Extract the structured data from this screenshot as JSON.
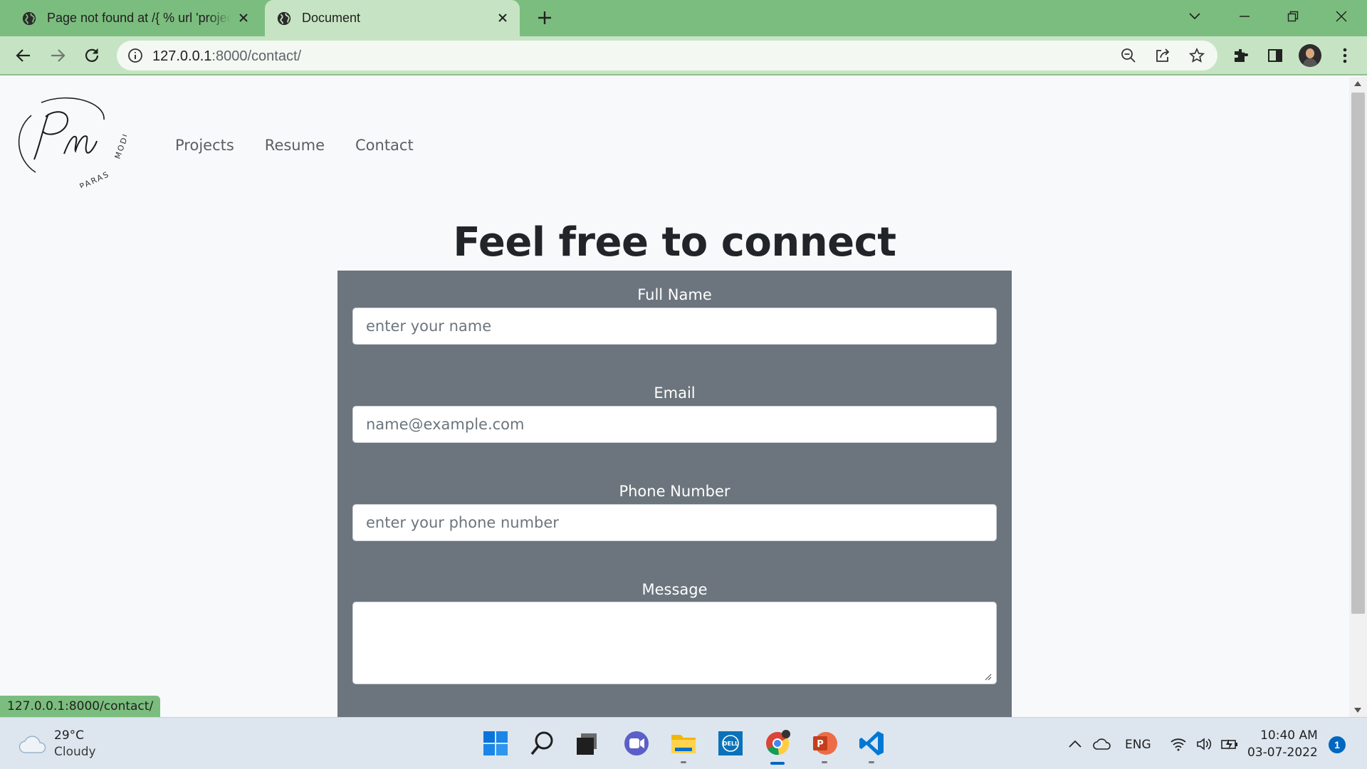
{
  "browser": {
    "tabs": [
      {
        "title": "Page not found at /{ % url 'projects' %}",
        "active": false
      },
      {
        "title": "Document",
        "active": true
      }
    ],
    "url": {
      "host": "127.0.0.1",
      "path": ":8000/contact/"
    },
    "colors": {
      "tab_strip": "#7bbd7e",
      "toolbar": "#c6e4c3"
    }
  },
  "page": {
    "logo": {
      "monogram": "Pm",
      "name": "PARAS MODI"
    },
    "nav": [
      {
        "label": "Projects"
      },
      {
        "label": "Resume"
      },
      {
        "label": "Contact"
      }
    ],
    "heading": "Feel free to connect",
    "form": {
      "card_color": "#6c757d",
      "fields": [
        {
          "label": "Full Name",
          "placeholder": "enter your name",
          "value": ""
        },
        {
          "label": "Email",
          "placeholder": "name@example.com",
          "value": ""
        },
        {
          "label": "Phone Number",
          "placeholder": "enter your phone number",
          "value": ""
        },
        {
          "label": "Message",
          "placeholder": "",
          "value": ""
        }
      ]
    },
    "status_url": "127.0.0.1:8000/contact/"
  },
  "taskbar": {
    "weather": {
      "temp": "29°C",
      "condition": "Cloudy"
    },
    "apps": [
      "start-icon",
      "search-icon",
      "task-view-icon",
      "chat-icon",
      "file-explorer-icon",
      "dell-icon",
      "chrome-icon",
      "powerpoint-icon",
      "vscode-icon"
    ],
    "language": "ENG",
    "time": "10:40 AM",
    "date": "03-07-2022",
    "notifications": "1"
  }
}
